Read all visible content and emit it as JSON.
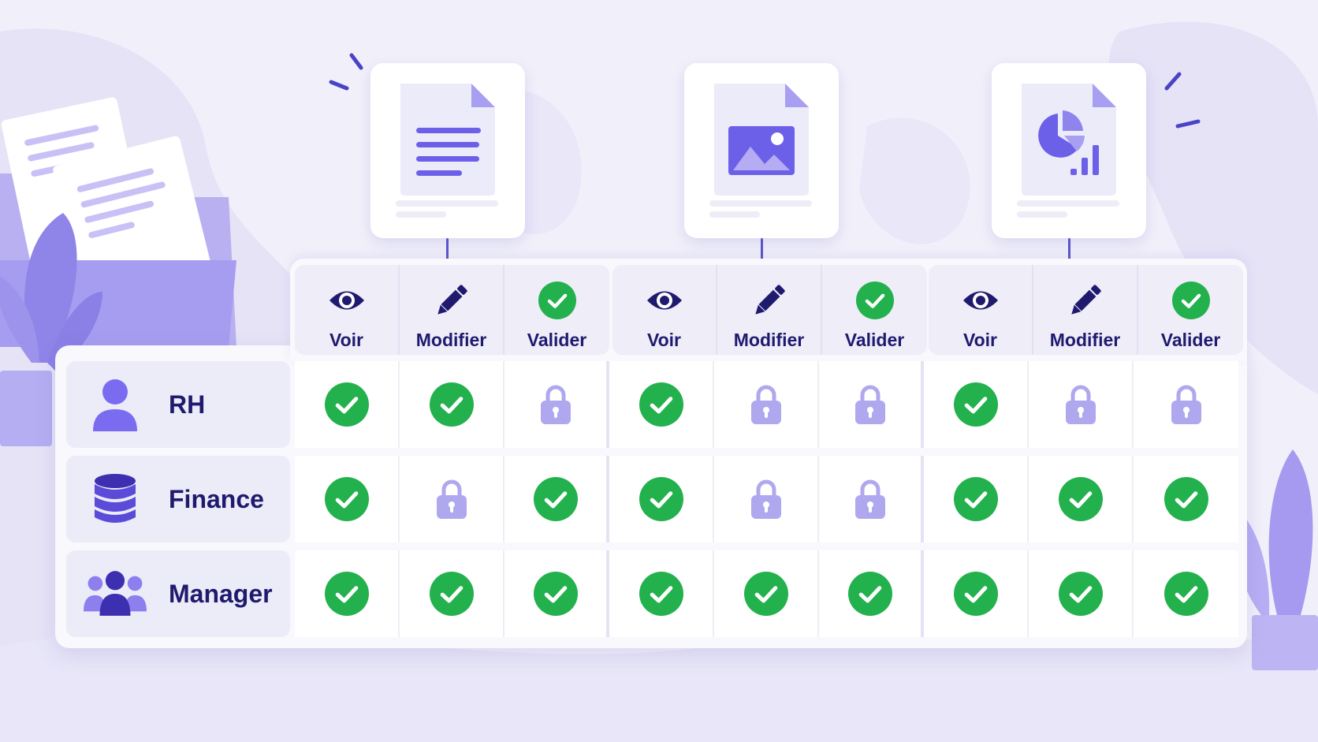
{
  "colors": {
    "background": "#f1f0fa",
    "accent_purple": "#7a6cf0",
    "dark_indigo": "#1f1a6e",
    "check_green": "#23b14d",
    "lock_lavender": "#b0a8ee"
  },
  "documents": [
    {
      "name": "text-document",
      "icon": "text-lines-icon"
    },
    {
      "name": "image-document",
      "icon": "image-icon"
    },
    {
      "name": "report-document",
      "icon": "pie-chart-icon"
    }
  ],
  "permissions": {
    "groups": [
      {
        "columns": [
          {
            "label": "Voir",
            "icon": "eye-icon"
          },
          {
            "label": "Modifier",
            "icon": "pencil-icon"
          },
          {
            "label": "Valider",
            "icon": "check-circle-icon"
          }
        ]
      },
      {
        "columns": [
          {
            "label": "Voir",
            "icon": "eye-icon"
          },
          {
            "label": "Modifier",
            "icon": "pencil-icon"
          },
          {
            "label": "Valider",
            "icon": "check-circle-icon"
          }
        ]
      },
      {
        "columns": [
          {
            "label": "Voir",
            "icon": "eye-icon"
          },
          {
            "label": "Modifier",
            "icon": "pencil-icon"
          },
          {
            "label": "Valider",
            "icon": "check-circle-icon"
          }
        ]
      }
    ]
  },
  "roles": [
    {
      "label": "RH",
      "icon": "user-icon",
      "access": [
        "check",
        "check",
        "lock",
        "check",
        "lock",
        "lock",
        "check",
        "lock",
        "lock"
      ]
    },
    {
      "label": "Finance",
      "icon": "database-icon",
      "access": [
        "check",
        "lock",
        "check",
        "check",
        "lock",
        "lock",
        "check",
        "check",
        "check"
      ]
    },
    {
      "label": "Manager",
      "icon": "team-icon",
      "access": [
        "check",
        "check",
        "check",
        "check",
        "check",
        "check",
        "check",
        "check",
        "check"
      ]
    }
  ]
}
